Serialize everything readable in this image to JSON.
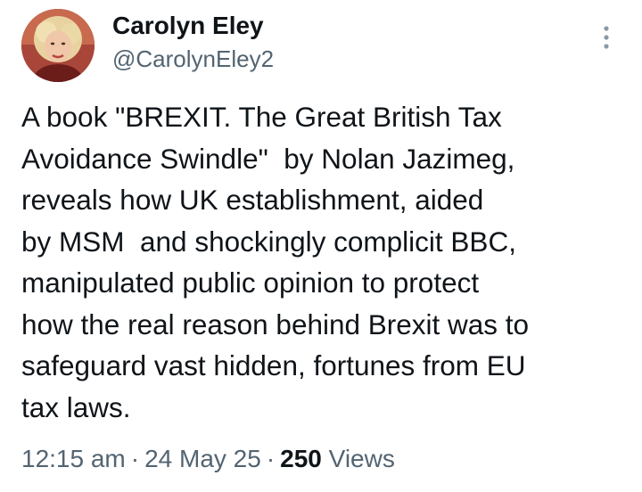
{
  "author": {
    "display_name": "Carolyn Eley",
    "handle": "@CarolynEley2",
    "avatar_icon": "profile-photo-avatar"
  },
  "menu": {
    "icon": "more-vertical-icon"
  },
  "tweet": {
    "lines": [
      "A book \"BREXIT. The Great British Tax",
      "Avoidance Swindle\"  by Nolan Jazimeg,",
      "reveals how UK establishment, aided",
      "by MSM  and shockingly complicit BBC,",
      "manipulated public opinion to protect",
      "how the real reason behind Brexit was to",
      "safeguard vast hidden, fortunes from EU",
      "tax laws."
    ]
  },
  "meta": {
    "time": "12:15 am",
    "separator": "·",
    "date": "24 May 25",
    "views_count": "250",
    "views_label": "Views"
  },
  "colors": {
    "text": "#0f1419",
    "secondary": "#536471",
    "background": "#ffffff"
  }
}
